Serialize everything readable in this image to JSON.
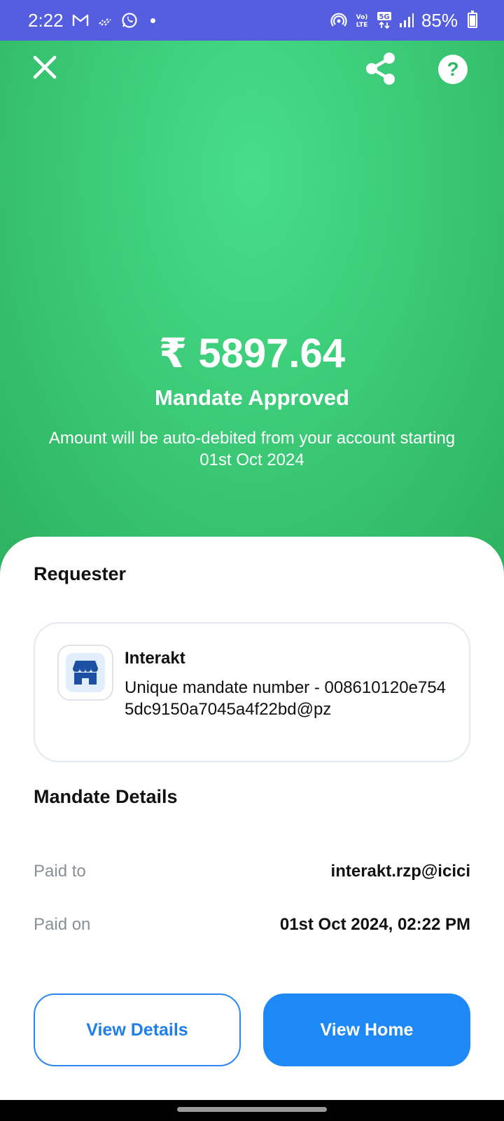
{
  "status_bar": {
    "time": "2:22",
    "battery": "85%",
    "battery_level": 0.85,
    "icons": [
      "gmail-icon",
      "cast-icon",
      "whatsapp-icon",
      "notification-dot",
      "hotspot-icon",
      "volte-icon",
      "5g-icon",
      "signal-icon",
      "battery-icon"
    ]
  },
  "header": {
    "close_icon": "close-icon",
    "share_icon": "share-icon",
    "help_label": "?"
  },
  "hero": {
    "amount": "₹ 5897.64",
    "status": "Mandate Approved",
    "subtitle": "Amount will be auto-debited from your account starting  01st Oct 2024",
    "bg_color": "#3ccb78"
  },
  "requester": {
    "section_title": "Requester",
    "name": "Interakt",
    "mandate_text": "Unique mandate number - 008610120e7545dc9150a7045a4f22bd@pz"
  },
  "mandate_details": {
    "section_title": "Mandate Details",
    "rows": [
      {
        "label": "Paid to",
        "value": "interakt.rzp@icici"
      },
      {
        "label": "Paid on",
        "value": "01st Oct 2024, 02:22 PM"
      }
    ]
  },
  "actions": {
    "view_details": "View Details",
    "view_home": "View Home",
    "primary_color": "#1e88f7"
  }
}
